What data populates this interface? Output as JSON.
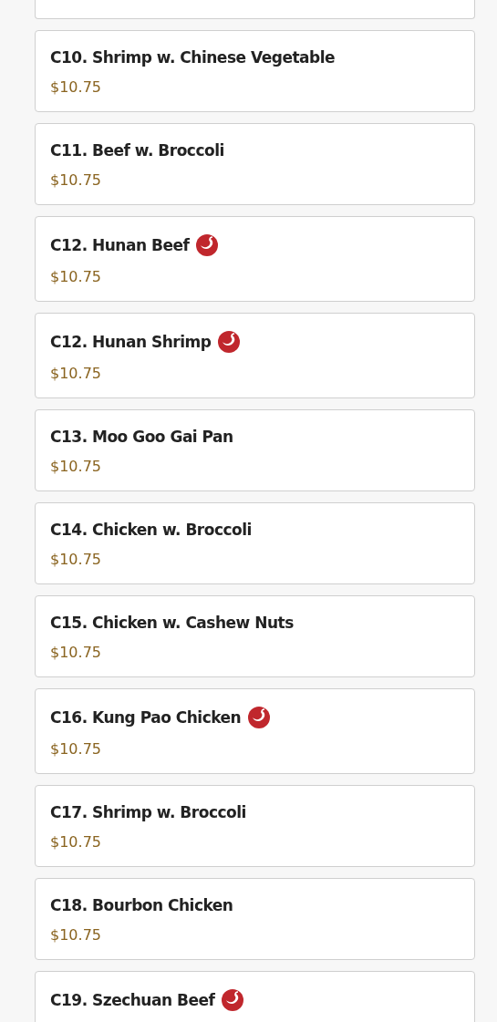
{
  "items": [
    {
      "name": "C10. Shrimp w. Chinese Vegetable",
      "price": "$10.75",
      "spicy": false
    },
    {
      "name": "C11. Beef w. Broccoli",
      "price": "$10.75",
      "spicy": false
    },
    {
      "name": "C12. Hunan Beef",
      "price": "$10.75",
      "spicy": true
    },
    {
      "name": "C12. Hunan Shrimp",
      "price": "$10.75",
      "spicy": true
    },
    {
      "name": "C13. Moo Goo Gai Pan",
      "price": "$10.75",
      "spicy": false
    },
    {
      "name": "C14. Chicken w. Broccoli",
      "price": "$10.75",
      "spicy": false
    },
    {
      "name": "C15. Chicken w. Cashew Nuts",
      "price": "$10.75",
      "spicy": false
    },
    {
      "name": "C16. Kung Pao Chicken",
      "price": "$10.75",
      "spicy": true
    },
    {
      "name": "C17. Shrimp w. Broccoli",
      "price": "$10.75",
      "spicy": false
    },
    {
      "name": "C18. Bourbon Chicken",
      "price": "$10.75",
      "spicy": false
    },
    {
      "name": "C19. Szechuan Beef",
      "spicy": true
    }
  ]
}
